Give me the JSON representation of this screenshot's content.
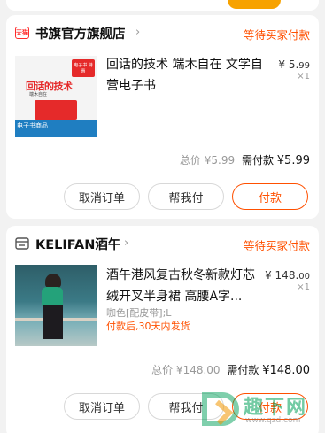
{
  "orders": [
    {
      "shop_name": "书旗官方旗舰店",
      "shop_icon": "tmall-icon",
      "shop_icon_text": "天猫",
      "status": "等待买家付款",
      "product_title": "回话的技术 端木自在 文学自营电子书",
      "price_symbol": "¥",
      "price_int": "5.",
      "price_dec": "99",
      "quantity": "×1",
      "total_label": "总价",
      "total_value": "¥5.99",
      "paid_label": "需付款",
      "paid_value": "¥5.99",
      "buttons": [
        "取消订单",
        "帮我付",
        "付款"
      ],
      "cover": {
        "badge": "电子书 特惠",
        "title": "回话的技术",
        "subtitle": "端木自在",
        "footer": "电子书商品"
      }
    },
    {
      "shop_name": "KELIFAN酒午",
      "shop_icon": "store-icon",
      "status": "等待买家付款",
      "product_title": "酒午港风复古秋冬新款灯芯绒开叉半身裙 高腰A字...",
      "price_symbol": "¥",
      "price_int": "148.",
      "price_dec": "00",
      "quantity": "×1",
      "sku": "咖色[配皮带];L",
      "shipping": "付款后,30天内发货",
      "total_label": "总价",
      "total_value": "¥148.00",
      "paid_label": "需付款",
      "paid_value": "¥148.00",
      "buttons": [
        "取消订单",
        "帮我付",
        "付款"
      ]
    }
  ],
  "watermark": {
    "text": "趣下网",
    "url": "www.qzd.com"
  },
  "colors": {
    "accent": "#ff5000",
    "background": "#f2f2f2",
    "card": "#ffffff"
  }
}
